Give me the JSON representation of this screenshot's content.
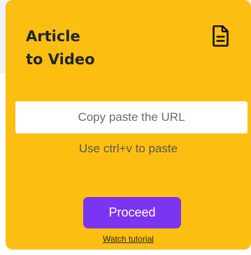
{
  "card": {
    "title_line1": "Article",
    "title_line2": "to Video",
    "icon": "document-icon",
    "url_input": {
      "value": "",
      "placeholder": "Copy paste the URL"
    },
    "hint": "Use ctrl+v to paste",
    "proceed_label": "Proceed",
    "tutorial_label": "Watch tutorial"
  },
  "colors": {
    "card_background": "#fcbf11",
    "button_background": "#7b34f0",
    "page_band": "#f1f2f5"
  }
}
